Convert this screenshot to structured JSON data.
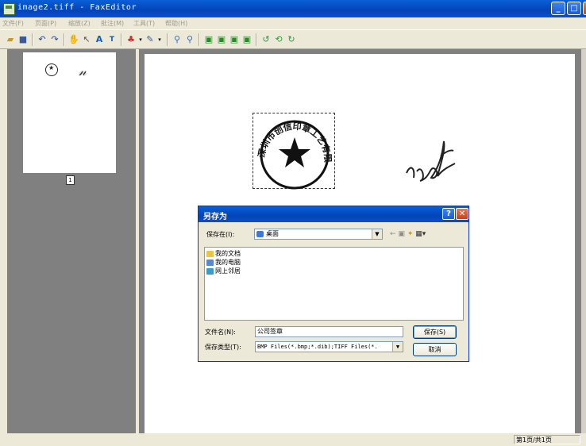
{
  "window": {
    "title": "image2.tiff - FaxEditor",
    "minimize_label": "_",
    "maximize_label": "□",
    "close_label": "✕"
  },
  "menu": {
    "items": [
      "文件(F)",
      "页面(P)",
      "缩放(Z)",
      "批注(M)",
      "工具(T)",
      "帮助(H)"
    ]
  },
  "thumbnail": {
    "page_number": "1"
  },
  "stamp": {
    "ring_text": "深圳市创信印章工艺有限公司"
  },
  "status": {
    "page_indicator": "第1页/共1页"
  },
  "save_dialog": {
    "title": "另存为",
    "help_label": "?",
    "close_label": "✕",
    "save_in_label": "保存在(I):",
    "save_in_value": "桌面",
    "list_items": [
      {
        "label": "我的文档",
        "icon": "folder-documents-icon",
        "color": "#e8c448"
      },
      {
        "label": "我的电脑",
        "icon": "computer-icon",
        "color": "#5a88c8"
      },
      {
        "label": "网上邻居",
        "icon": "network-icon",
        "color": "#3a9ac8"
      }
    ],
    "filename_label": "文件名(N):",
    "filename_value": "公司签章",
    "filetype_label": "保存类型(T):",
    "filetype_value": "BMP Files(*.bmp;*.dib);TIFF Files(*.",
    "save_button": "保存(S)",
    "cancel_button": "取消"
  }
}
